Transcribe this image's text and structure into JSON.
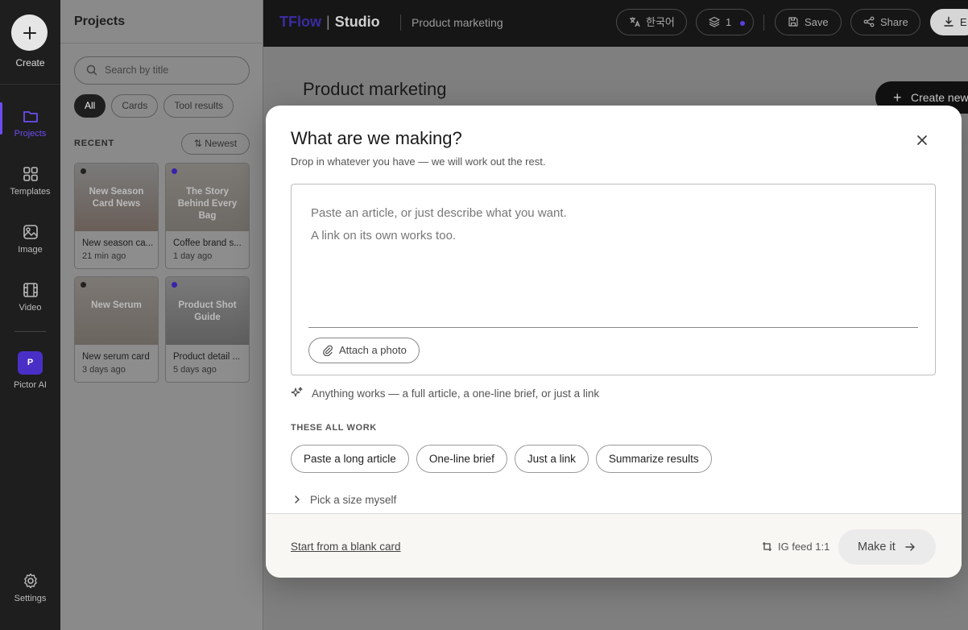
{
  "rail": {
    "create_label": "Create",
    "items": [
      {
        "label": "Projects"
      },
      {
        "label": "Templates"
      },
      {
        "label": "Image"
      },
      {
        "label": "Video"
      },
      {
        "label": "Pictor AI",
        "badge": "P"
      }
    ],
    "settings_label": "Settings"
  },
  "panel": {
    "title": "Projects",
    "search_placeholder": "Search by title",
    "filters": [
      "All",
      "Cards",
      "Tool results"
    ],
    "recent_label": "RECENT",
    "sort_label": "Newest",
    "cards": [
      {
        "thumb_title": "New Season Card News",
        "name": "New season ca...",
        "when": "21 min ago"
      },
      {
        "thumb_title": "The Story Behind Every Bag",
        "name": "Coffee brand s...",
        "when": "1 day ago"
      },
      {
        "thumb_title": "New Serum",
        "name": "New serum card",
        "when": "3 days ago"
      },
      {
        "thumb_title": "Product Shot Guide",
        "name": "Product detail ...",
        "when": "5 days ago"
      }
    ]
  },
  "topbar": {
    "brand_a": "TFlow",
    "brand_b": "Studio",
    "crumb": "Product marketing",
    "lang": "한국어",
    "layers_count": "1",
    "save": "Save",
    "share": "Share",
    "export": "E"
  },
  "main": {
    "title": "Product marketing",
    "create_new": "Create new"
  },
  "modal": {
    "title": "What are we making?",
    "subtitle": "Drop in whatever you have — we will work out the rest.",
    "placeholder_line1": "Paste an article, or just describe what you want.",
    "placeholder_line2": "A link on its own works too.",
    "attach_label": "Attach a photo",
    "hint": "Anything works — a full article, a one-line brief, or just a link",
    "section_label": "THESE ALL WORK",
    "suggestions": [
      "Paste a long article",
      "One-line brief",
      "Just a link",
      "Summarize results"
    ],
    "pick_size": "Pick a size myself",
    "blank_card": "Start from a blank card",
    "size_label": "IG feed 1:1",
    "make_label": "Make it"
  },
  "colors": {
    "accent": "#6b4cf0",
    "rail_bg": "#1e1e1e",
    "topbar_bg": "#161616"
  }
}
